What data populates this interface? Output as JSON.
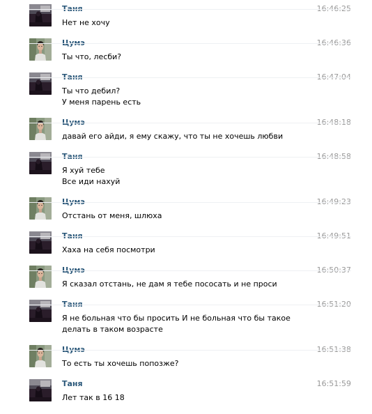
{
  "messages": [
    {
      "author": "Таня",
      "avatar": "tanya",
      "time": "16:46:25",
      "lines": [
        "Нет не хочу"
      ]
    },
    {
      "author": "Цумэ",
      "avatar": "tsume",
      "time": "16:46:36",
      "lines": [
        "Ты что, лесби?"
      ]
    },
    {
      "author": "Таня",
      "avatar": "tanya",
      "time": "16:47:04",
      "lines": [
        "Ты что дебил?",
        "У меня парень есть"
      ]
    },
    {
      "author": "Цумэ",
      "avatar": "tsume",
      "time": "16:48:18",
      "lines": [
        "давай его айди, я ему скажу, что ты не хочешь любви"
      ]
    },
    {
      "author": "Таня",
      "avatar": "tanya",
      "time": "16:48:58",
      "lines": [
        "Я хуй тебе",
        "Все иди нахуй"
      ]
    },
    {
      "author": "Цумэ",
      "avatar": "tsume",
      "time": "16:49:23",
      "lines": [
        "Отстань от меня, шлюха"
      ]
    },
    {
      "author": "Таня",
      "avatar": "tanya",
      "time": "16:49:51",
      "lines": [
        "Хаха на себя посмотри"
      ]
    },
    {
      "author": "Цумэ",
      "avatar": "tsume",
      "time": "16:50:37",
      "lines": [
        "Я сказал отстань, не дам я тебе пососать и не проси"
      ]
    },
    {
      "author": "Таня",
      "avatar": "tanya",
      "time": "16:51:20",
      "lines": [
        "Я не больная что бы просить И не больная что бы такое делать в таком возрасте"
      ]
    },
    {
      "author": "Цумэ",
      "avatar": "tsume",
      "time": "16:51:38",
      "lines": [
        "То есть ты хочешь попозже?"
      ]
    },
    {
      "author": "Таня",
      "avatar": "tanya",
      "time": "16:51:59",
      "lines": [
        "Лет так в 16 18"
      ]
    }
  ],
  "colors": {
    "author": "#2b587a",
    "time": "#999999",
    "text": "#000000",
    "background": "#ffffff"
  }
}
